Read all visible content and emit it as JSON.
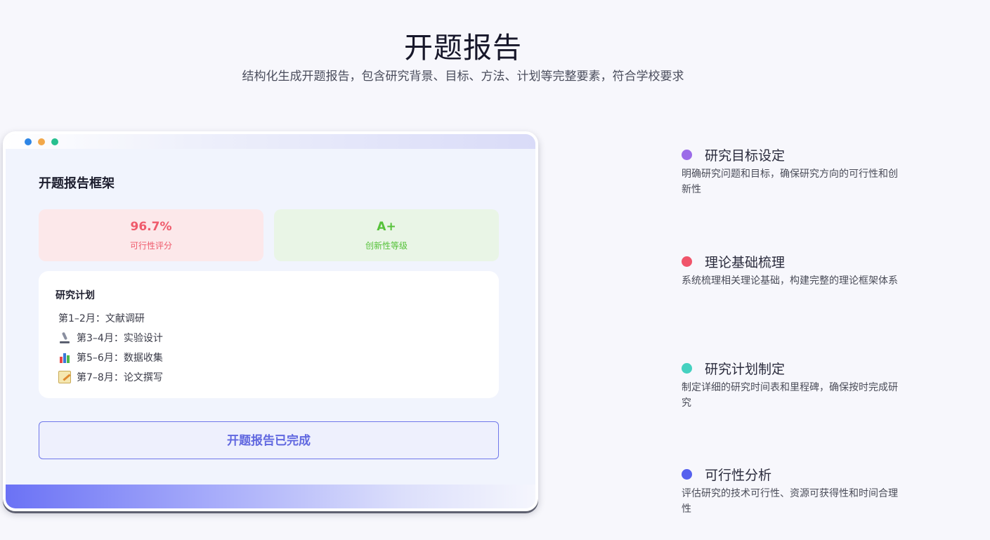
{
  "hero": {
    "title": "开题报告",
    "subtitle": "结构化生成开题报告，包含研究背景、目标、方法、计划等完整要素，符合学校要求"
  },
  "mockup": {
    "window_dots": [
      "#2e86e6",
      "#f2a84a",
      "#27c08f"
    ],
    "panel_title": "开题报告框架",
    "metrics": [
      {
        "value": "96.7%",
        "label": "可行性评分",
        "color": "#ef5a6b"
      },
      {
        "value": "A+",
        "label": "创新性等级",
        "color": "#56c23a"
      }
    ],
    "plan": {
      "title": "研究计划",
      "items": [
        {
          "icon": "none",
          "text": "第1–2月：文献调研"
        },
        {
          "icon": "microscope-icon",
          "text": "第3–4月：实验设计"
        },
        {
          "icon": "bar-chart-icon",
          "text": "第5–6月：数据收集"
        },
        {
          "icon": "memo-icon",
          "text": "第7–8月：论文撰写"
        }
      ]
    },
    "done_button": "开题报告已完成"
  },
  "features": [
    {
      "title": "研究目标设定",
      "desc": "明确研究问题和目标，确保研究方向的可行性和创新性",
      "color": "#9b6be8"
    },
    {
      "title": "理论基础梳理",
      "desc": "系统梳理相关理论基础，构建完整的理论框架体系",
      "color": "#f0546a"
    },
    {
      "title": "研究计划制定",
      "desc": "制定详细的研究时间表和里程碑，确保按时完成研究",
      "color": "#45d1c0"
    },
    {
      "title": "可行性分析",
      "desc": "评估研究的技术可行性、资源可获得性和时间合理性",
      "color": "#5560ee"
    }
  ]
}
